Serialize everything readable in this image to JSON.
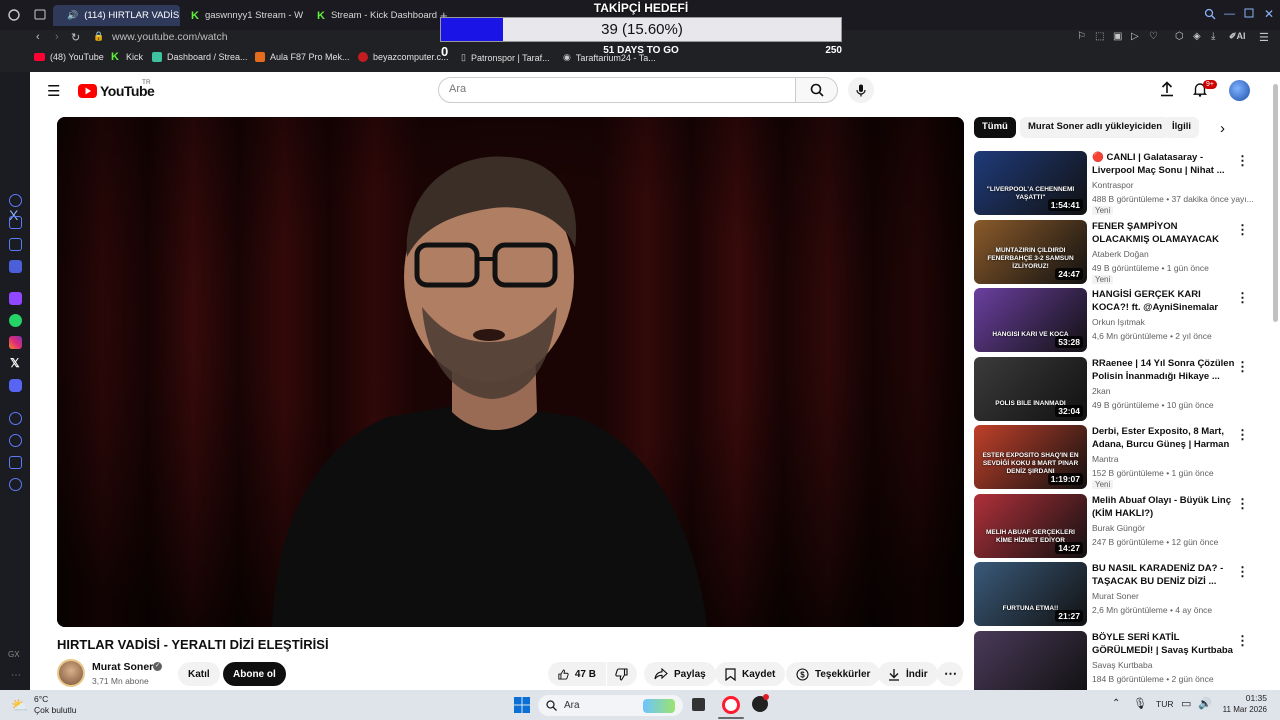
{
  "tabs": [
    {
      "label": "(114) HIRTLAR VADİSİ"
    },
    {
      "label": "gaswnnyy1 Stream - Watc"
    },
    {
      "label": "Stream - Kick Dashboard"
    }
  ],
  "address": {
    "url": "www.youtube.com/watch"
  },
  "bookmarks": [
    {
      "label": "(48) YouTube"
    },
    {
      "label": "Kick"
    },
    {
      "label": "Dashboard / Strea..."
    },
    {
      "label": "Aula F87 Pro Mek..."
    },
    {
      "label": "beyazcomputer.c..."
    },
    {
      "label": "Patronspor | Taraf..."
    },
    {
      "label": "Taraftarium24 - Ta..."
    }
  ],
  "goal": {
    "title": "TAKİPÇİ HEDEFİ",
    "value_label": "39 (15.60%)",
    "progress": 0.156,
    "min": "0",
    "max": "250",
    "days": "51 DAYS TO GO"
  },
  "youtube": {
    "logo": "YouTube",
    "region": "TR",
    "search_placeholder": "Ara",
    "notif_count": "9+"
  },
  "video": {
    "title": "HIRTLAR VADİSİ - YERALTI DİZİ ELEŞTİRİSİ",
    "channel": "Murat Soner",
    "subs": "3,71 Mn abone",
    "join": "Katıl",
    "subscribe": "Abone ol",
    "likes": "47 B",
    "share": "Paylaş",
    "save": "Kaydet",
    "thanks": "Teşekkürler",
    "download": "İndir"
  },
  "chips": [
    "Tümü",
    "Murat Soner adlı yükleyiciden",
    "İlgili"
  ],
  "recs": [
    {
      "title": "🔴 CANLI | Galatasaray - Liverpool Maç Sonu | Nihat ...",
      "channel": "Kontraspor",
      "meta": "488 B görüntüleme • 37 dakika önce yayı...",
      "badge": "Yeni",
      "duration": "1:54:41",
      "thumb_text": "\"LIVERPOOL'A CEHENNEMİ YAŞATTI\"",
      "color": "#1f3b7a"
    },
    {
      "title": "FENER ŞAMPİYON OLACAKMIŞ OLAMAYACAK ULAN! ...",
      "channel": "Ataberk Doğan",
      "meta": "49 B görüntüleme • 1 gün önce",
      "badge": "Yeni",
      "duration": "24:47",
      "thumb_text": "MÜNTAZIRİN ÇILDIRDI FENERBAHÇE 3-2 SAMSUN İZLİYORUZ!",
      "color": "#8a5a2a"
    },
    {
      "title": "HANGİSİ GERÇEK KARI KOCA?! ft. @AyniSinemalar",
      "channel": "Orkun Işıtmak",
      "meta": "4,6 Mn görüntüleme • 2 yıl önce",
      "badge": "",
      "duration": "53:28",
      "thumb_text": "HANGİSİ KARI VE KOCA",
      "color": "#6b3fa0"
    },
    {
      "title": "RRaenee | 14 Yıl Sonra Çözülen Polisin İnanmadığı Hikaye ...",
      "channel": "2kan",
      "meta": "49 B görüntüleme • 10 gün önce",
      "badge": "",
      "duration": "32:04",
      "thumb_text": "POLİS BİLE İNANMADI",
      "color": "#3b3b3b"
    },
    {
      "title": "Derbi, Ester Exposito, 8 Mart, Adana, Burcu Güneş | Harman ...",
      "channel": "Mantra",
      "meta": "152 B görüntüleme • 1 gün önce",
      "badge": "Yeni",
      "duration": "1:19:07",
      "thumb_text": "ESTER EXPOSITO SHAQ'IN EN SEVDİĞİ KOKU 8 MART PINAR DENİZ ŞIRDANI",
      "color": "#c0402a"
    },
    {
      "title": "Melih Abuaf Olayı - Büyük Linç (KİM HAKLI?)",
      "channel": "Burak Güngör",
      "meta": "247 B görüntüleme • 12 gün önce",
      "badge": "",
      "duration": "14:27",
      "thumb_text": "MELİH ABUAF GERÇEKLERİ KİME HİZMET EDİYOR",
      "color": "#b0303a"
    },
    {
      "title": "BU NASIL KARADENİZ DA? - TAŞACAK BU DENİZ DİZİ ...",
      "channel": "Murat Soner",
      "meta": "2,6 Mn görüntüleme • 4 ay önce",
      "badge": "",
      "duration": "21:27",
      "thumb_text": "FURTUNA ETMA!!",
      "color": "#3a5a7a"
    },
    {
      "title": "BÖYLE SERİ KATİL GÖRÜLMEDİ! | Savaş Kurtbaba ile Suçun ...",
      "channel": "Savaş Kurtbaba",
      "meta": "184 B görüntüleme • 2 gün önce",
      "badge": "",
      "duration": "",
      "thumb_text": "",
      "color": "#4a3a5a"
    }
  ],
  "taskbar": {
    "weather_temp": "6°C",
    "weather_desc": "Çok bulutlu",
    "search": "Ara",
    "lang": "TUR",
    "time": "01:35",
    "date": "11 Mar 2026"
  },
  "colors": {
    "yt_red": "#ff0000",
    "goal_fill": "#1a14e6"
  }
}
